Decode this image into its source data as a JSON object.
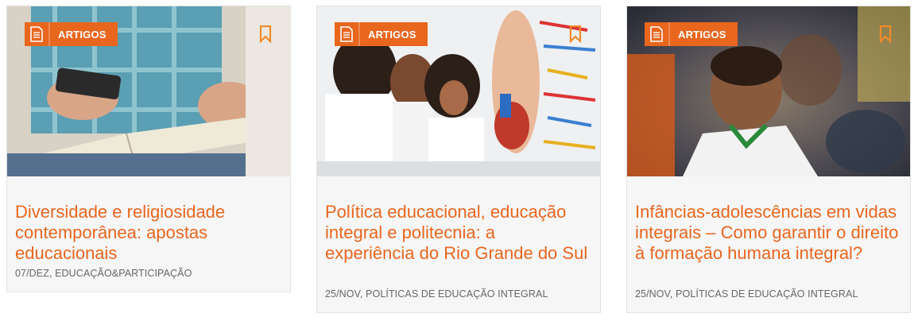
{
  "accent_color": "#e8661e",
  "cards": [
    {
      "badge": "ARTIGOS",
      "image_subject": "hands-holding-phone-over-open-bible",
      "title": "Diversidade e religiosidade contemporânea: apostas educacionais",
      "meta": "07/DEZ, EDUCAÇÃO&PARTICIPAÇÃO"
    },
    {
      "badge": "ARTIGOS",
      "image_subject": "students-with-anatomy-model",
      "title": "Política educacional, educação integral e politecnia: a experiência do Rio Grande do Sul",
      "meta": "25/NOV, POLÍTICAS DE EDUCAÇÃO INTEGRAL"
    },
    {
      "badge": "ARTIGOS",
      "image_subject": "children-in-motion-blur",
      "title": "Infâncias-adolescências em vidas integrais – Como garantir o direito à formação humana integral?",
      "meta": "25/NOV, POLÍTICAS DE EDUCAÇÃO INTEGRAL"
    }
  ],
  "icons": {
    "badge": "document-icon",
    "save": "bookmark-icon"
  }
}
